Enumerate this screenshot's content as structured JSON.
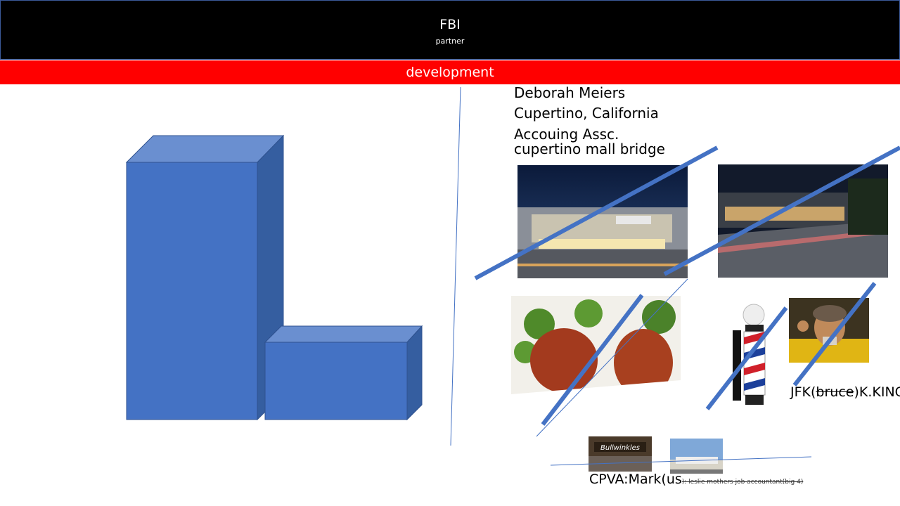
{
  "header": {
    "title": "FBI",
    "subtitle": "partner"
  },
  "banner": {
    "label": "development"
  },
  "info": {
    "name": "Deborah Meiers",
    "location": "Cupertino, California",
    "org_line1": "Accouing Assc.",
    "org_line2": "cupertino mall bridge"
  },
  "captions": {
    "jfk_prefix": "JFK(",
    "jfk_struck": "bruce",
    "jfk_suffix": ")K.KING",
    "cpva_main": "CPVA:Mark(us",
    "cpva_small": "): leslie mothers job accountant(big 4)"
  },
  "images": [
    {
      "name": "mall-night-photo",
      "alt": "mall at night"
    },
    {
      "name": "street-night-photo",
      "alt": "street at night"
    },
    {
      "name": "meatballs-photo",
      "alt": "meatballs with broccoli"
    },
    {
      "name": "barber-pole-photo",
      "alt": "barber pole"
    },
    {
      "name": "person-photo",
      "alt": "smiling man in yellow"
    },
    {
      "name": "bullwinkles-sign-photo",
      "alt": "Bullwinkles storefront"
    },
    {
      "name": "building-photo",
      "alt": "low building"
    }
  ],
  "colors": {
    "bar_front": "#4472c4",
    "bar_top": "#6a8fd0",
    "bar_side": "#355ea0",
    "slash": "#4472c4",
    "banner": "#ff0000",
    "header": "#000000"
  }
}
